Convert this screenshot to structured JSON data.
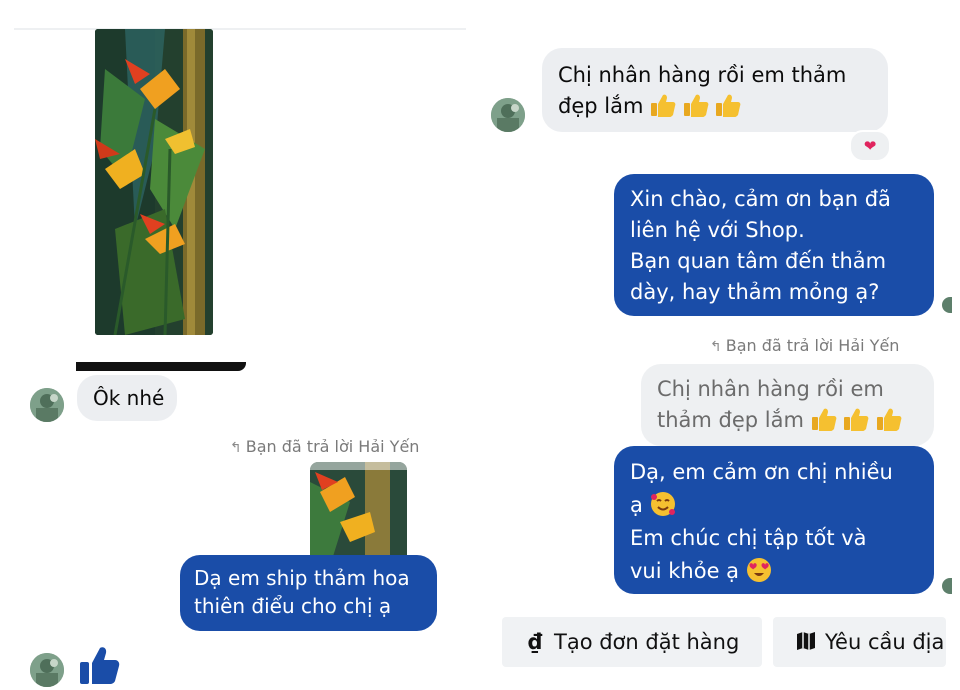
{
  "left_chat": {
    "ok_message": "Ôk nhé",
    "reply_note": "Bạn đã trả lời Hải Yến",
    "ship_message": "Dạ em ship thảm hoa thiên điểu cho chị ạ"
  },
  "right_chat": {
    "incoming_message_line1": "Chị nhân hàng rồi em thảm",
    "incoming_message_line2": "đẹp lắm",
    "reaction": "❤",
    "shop_greeting_lines": [
      "Xin chào, cảm ơn bạn đã",
      "liên hệ với Shop.",
      "Bạn quan tâm đến thảm",
      "dày, hay thảm mỏng ạ?"
    ],
    "reply_note": "Bạn đã trả lời Hải Yến",
    "quoted_line1": "Chị nhân hàng rồi em",
    "quoted_line2": "thảm đẹp lắm",
    "thanks_line1": "Dạ, em cảm ơn chị nhiều",
    "thanks_line2": "ạ",
    "thanks_line3": "Em chúc chị tập tốt và",
    "thanks_line4": "vui khỏe ạ"
  },
  "actions": {
    "create_order_icon": "₫",
    "create_order_label": "Tạo đơn đặt hàng",
    "request_address_label": "Yêu cầu địa"
  },
  "icons": {
    "like": "thumbs-up-icon",
    "map": "map-icon",
    "heart": "heart-icon"
  },
  "colors": {
    "outgoing_bubble": "#1a4da8",
    "incoming_bubble": "#eceef1",
    "like_blue": "#1a4da8"
  }
}
